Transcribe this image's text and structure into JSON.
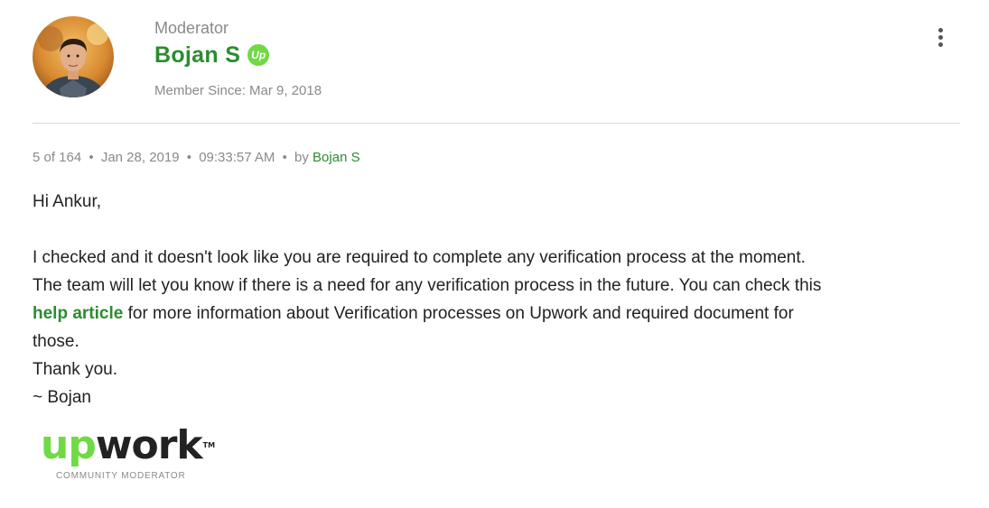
{
  "author": {
    "role": "Moderator",
    "name": "Bojan S",
    "badge": "Up",
    "member_since": "Member Since: Mar 9, 2018"
  },
  "meta": {
    "position": "5 of 164",
    "date": "Jan 28, 2019",
    "time": "09:33:57 AM",
    "by_label": "by",
    "by_author": "Bojan S",
    "separator": "•"
  },
  "post": {
    "greeting": "Hi Ankur,",
    "line1": "I checked and it doesn't look like you are required to complete any verification process at the moment.",
    "line2": "The team will let you know if there is a need for any verification process in the future. You can check this",
    "link_text": "help article",
    "line3_rest": " for more information about Verification processes on Upwork and required document for",
    "line4": "those.",
    "thanks": "Thank you.",
    "signoff": "~ Bojan"
  },
  "signature": {
    "logo_up": "up",
    "logo_work": "work",
    "logo_tm": "TM",
    "subtitle": "COMMUNITY MODERATOR"
  },
  "colors": {
    "brand_green": "#2a8d2e",
    "upwork_green": "#6fda44",
    "muted": "#8a8a8a"
  },
  "icons": {
    "menu": "more-vertical-icon",
    "badge": "upwork-badge-icon"
  }
}
